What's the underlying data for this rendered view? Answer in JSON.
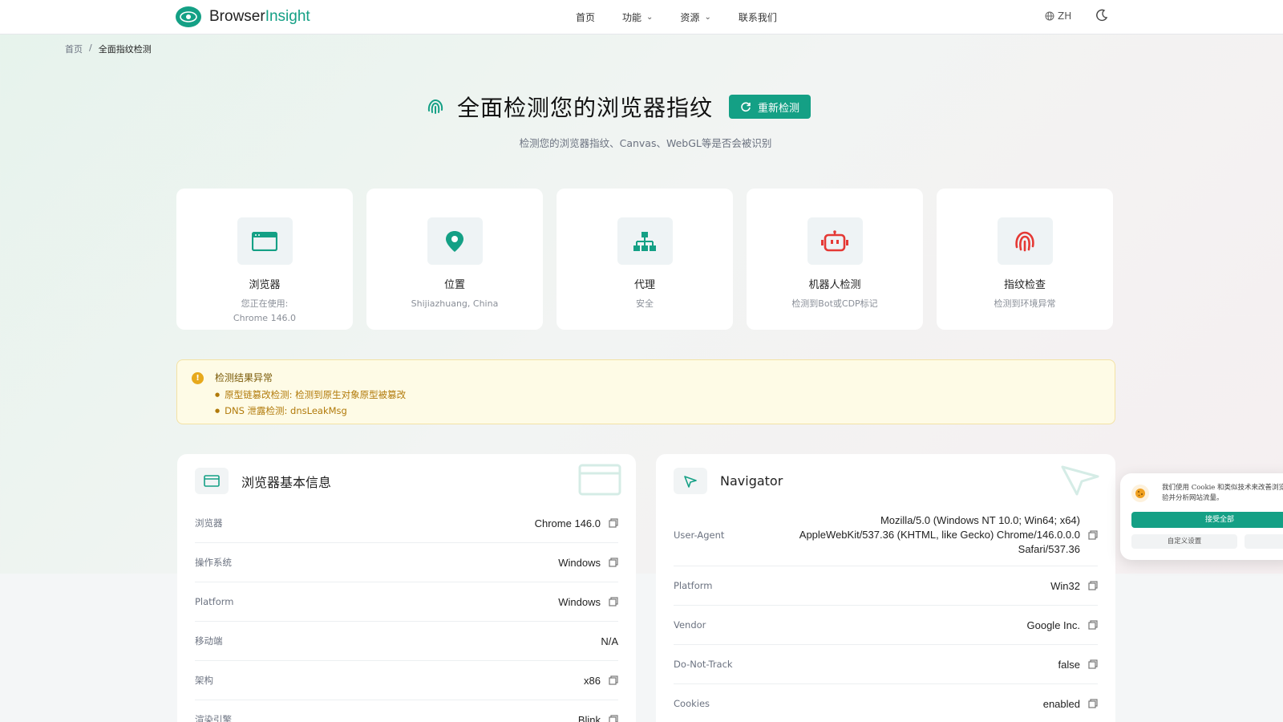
{
  "header": {
    "brand_plain": "Browser",
    "brand_accent": "Insight",
    "nav": [
      {
        "label": "首页"
      },
      {
        "label": "功能"
      },
      {
        "label": "资源"
      },
      {
        "label": "联系我们"
      }
    ],
    "lang": "ZH"
  },
  "breadcrumb": {
    "home": "首页",
    "sep": "/",
    "current": "全面指纹检测"
  },
  "hero": {
    "title": "全面检测您的浏览器指纹",
    "button": "重新检测",
    "subtitle": "检测您的浏览器指纹、Canvas、WebGL等是否会被识别"
  },
  "cards": [
    {
      "title": "浏览器",
      "sub1": "您正在使用:",
      "sub2": "Chrome 146.0"
    },
    {
      "title": "位置",
      "sub1": "Shijiazhuang, China",
      "sub2": ""
    },
    {
      "title": "代理",
      "sub1": "安全",
      "sub2": ""
    },
    {
      "title": "机器人检测",
      "sub1": "检测到Bot或CDP标记",
      "sub2": ""
    },
    {
      "title": "指纹检查",
      "sub1": "检测到环境异常",
      "sub2": ""
    }
  ],
  "alert": {
    "title": "检测结果异常",
    "items": [
      "原型链篡改检测: 检测到原生对象原型被篡改",
      "DNS 泄露检测: dnsLeakMsg"
    ]
  },
  "browser_panel": {
    "title": "浏览器基本信息",
    "rows": [
      {
        "label": "浏览器",
        "value": "Chrome 146.0"
      },
      {
        "label": "操作系统",
        "value": "Windows"
      },
      {
        "label": "Platform",
        "value": "Windows"
      },
      {
        "label": "移动端",
        "value": "N/A"
      },
      {
        "label": "架构",
        "value": "x86"
      },
      {
        "label": "渲染引擎",
        "value": "Blink"
      }
    ]
  },
  "navigator_panel": {
    "title": "Navigator",
    "ua_label": "User-Agent",
    "ua_line1": "Mozilla/5.0 (Windows NT 10.0; Win64; x64)",
    "ua_line2": "AppleWebKit/537.36 (KHTML, like Gecko) Chrome/146.0.0.0",
    "ua_line3": "Safari/537.36",
    "rows": [
      {
        "label": "Platform",
        "value": "Win32"
      },
      {
        "label": "Vendor",
        "value": "Google Inc."
      },
      {
        "label": "Do-Not-Track",
        "value": "false"
      },
      {
        "label": "Cookies",
        "value": "enabled"
      }
    ]
  },
  "cookie": {
    "text": "我们使用 Cookie 和类似技术来改善浏览体验并分析网站流量。",
    "accept": "接受全部",
    "custom": "自定义设置"
  },
  "colors": {
    "accent": "#14a085",
    "warning": "#e7a91c",
    "bot_red": "#e53935"
  }
}
